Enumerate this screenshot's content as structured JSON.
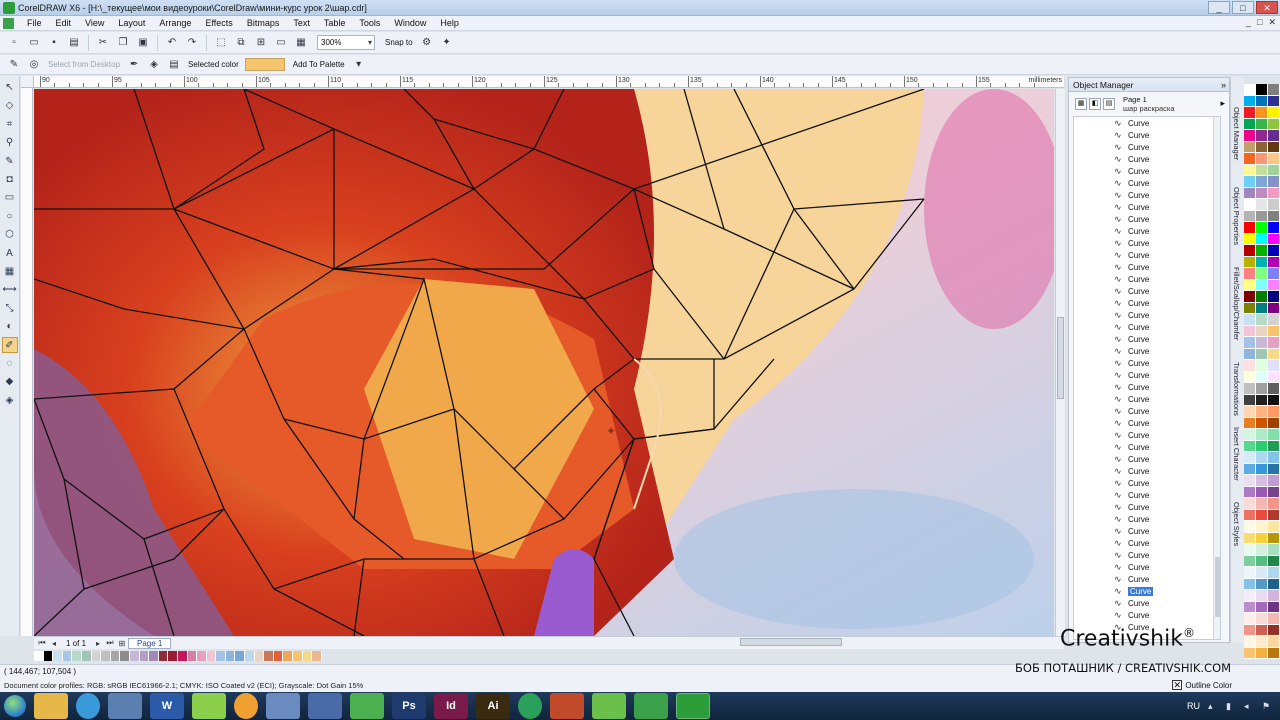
{
  "window": {
    "title": "CorelDRAW X6 - [H:\\_текущее\\мои видеоуроки\\CorelDraw\\мини-курс урок 2\\шар.cdr]",
    "minimize": "_",
    "maximize": "□",
    "close": "✕"
  },
  "menu": [
    "File",
    "Edit",
    "View",
    "Layout",
    "Arrange",
    "Effects",
    "Bitmaps",
    "Text",
    "Table",
    "Tools",
    "Window",
    "Help"
  ],
  "toolbar": {
    "zoom": "300%",
    "snap_to": "Snap to"
  },
  "propbar": {
    "select_from_desktop": "Select from Desktop",
    "selected_color_label": "Selected color",
    "selected_color": "#f5c46d",
    "add_to_palette": "Add To Palette"
  },
  "ruler": {
    "labels": [
      "90",
      "95",
      "100",
      "105",
      "110",
      "115",
      "120",
      "125",
      "130",
      "135",
      "140",
      "145",
      "150",
      "155"
    ],
    "unit": "millimeters"
  },
  "page_nav": {
    "count": "1 of 1",
    "tab": "Page 1"
  },
  "status": {
    "coords": "( 144,467; 107,504 )",
    "profiles": "Document color profiles: RGB: sRGB IEC61966-2.1; CMYK: ISO Coated v2 (ECI); Grayscale: Dot Gain 15%",
    "outline_color": "Outline Color"
  },
  "docker": {
    "title": "Object Manager",
    "page": "Page 1",
    "layer": "шар раскраска",
    "curve_label": "Curve",
    "curve_count": 43,
    "selected_index": 39
  },
  "docker_tabs": [
    "Object Manager",
    "Object Properties",
    "Fillet/Scallop/Chamfer",
    "Transformations",
    "Insert Character",
    "Object Styles"
  ],
  "watermark": {
    "logo": "Creativshik",
    "reg": "®",
    "author": "БОБ ПОТАШНИК / CREATIVSHIK.COM"
  },
  "tray": {
    "lang": "RU"
  },
  "colors": {
    "accent": "#3d7bd9",
    "bottom_palette": [
      "#ffffff",
      "#000000",
      "#c8e1f2",
      "#a7c7e7",
      "#b8d8c8",
      "#9fc5b3",
      "#d3d3d3",
      "#bfbfbf",
      "#a6a6a6",
      "#8c8c8c",
      "#c9b7d6",
      "#b69fc7",
      "#a387b6",
      "#8b2e3a",
      "#9b1b30",
      "#c2185b",
      "#d47fa6",
      "#e6a1c0",
      "#f2c4d6",
      "#a3c4e6",
      "#8fb5dd",
      "#7aa6d4",
      "#bcd6ea",
      "#e8d4c4",
      "#c97a5a",
      "#e2613a",
      "#f2a65a",
      "#f5c46d",
      "#f7d98a",
      "#e8b68f"
    ],
    "right_palette": [
      "#ffffff",
      "#000000",
      "#7f7f7f",
      "#00aeef",
      "#0072bc",
      "#2e3192",
      "#ed1c24",
      "#f7941d",
      "#fff200",
      "#00a651",
      "#39b54a",
      "#8dc63f",
      "#ec008c",
      "#92278f",
      "#662d91",
      "#c69c6d",
      "#8c6239",
      "#603913",
      "#f26522",
      "#f7977a",
      "#fdc689",
      "#fff799",
      "#c4df9b",
      "#a2d39c",
      "#6dcff6",
      "#7da7d9",
      "#8393ca",
      "#a186be",
      "#bd8cbf",
      "#f49ac1",
      "#ffffff",
      "#e6e6e6",
      "#cccccc",
      "#b3b3b3",
      "#999999",
      "#808080",
      "#ff0000",
      "#00ff00",
      "#0000ff",
      "#ffff00",
      "#00ffff",
      "#ff00ff",
      "#b30000",
      "#00b300",
      "#0000b3",
      "#b3b300",
      "#00b3b3",
      "#b300b3",
      "#ff8080",
      "#80ff80",
      "#8080ff",
      "#ffff80",
      "#80ffff",
      "#ff80ff",
      "#800000",
      "#008000",
      "#000080",
      "#808000",
      "#008080",
      "#800080",
      "#c8e1f2",
      "#b8d8c8",
      "#d3d3d3",
      "#f2c4d6",
      "#e8d4c4",
      "#f5c46d",
      "#a3c4e6",
      "#c9b7d6",
      "#e6a1c0",
      "#8fb5dd",
      "#9fc5b3",
      "#f7d98a",
      "#ffe0e0",
      "#e0ffe0",
      "#e0e0ff",
      "#ffffe0",
      "#e0ffff",
      "#ffe0ff",
      "#c0c0c0",
      "#a0a0a0",
      "#606060",
      "#404040",
      "#202020",
      "#101010",
      "#ffd5b3",
      "#ffb380",
      "#ff9966",
      "#e67e22",
      "#d35400",
      "#a04000",
      "#d5f5e3",
      "#abebc6",
      "#82e0aa",
      "#58d68d",
      "#2ecc71",
      "#239b56",
      "#d6eaf8",
      "#aed6f1",
      "#85c1e9",
      "#5dade2",
      "#3498db",
      "#2874a6",
      "#ebdef0",
      "#d7bde2",
      "#c39bd3",
      "#af7ac5",
      "#9b59b6",
      "#76448a",
      "#fadbd8",
      "#f5b7b1",
      "#f1948a",
      "#ec7063",
      "#e74c3c",
      "#b03a2e",
      "#fef9e7",
      "#fcf3cf",
      "#f9e79f",
      "#f7dc6f",
      "#f4d03f",
      "#b7950b",
      "#eafaf1",
      "#d4efdf",
      "#a9dfbf",
      "#7dcea0",
      "#52be80",
      "#1e8449",
      "#ebf5fb",
      "#d6eaf8",
      "#aed6f1",
      "#85c1e9",
      "#5499c7",
      "#1f618d",
      "#f5eef8",
      "#e8daef",
      "#d2b4de",
      "#bb8fce",
      "#a569bd",
      "#6c3483",
      "#fdedec",
      "#fadbd8",
      "#f5b7b1",
      "#f1948a",
      "#cd6155",
      "#943126",
      "#fef5e7",
      "#fdebd0",
      "#fad7a0",
      "#f8c471",
      "#f5b041",
      "#b9770e"
    ]
  }
}
